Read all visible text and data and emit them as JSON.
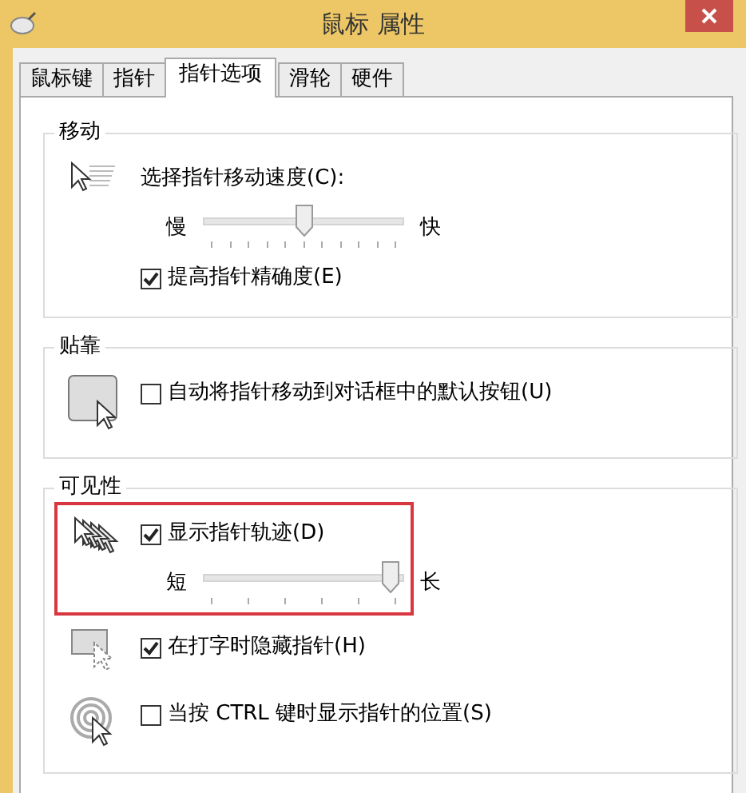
{
  "window": {
    "title": "鼠标 属性"
  },
  "tabs": [
    {
      "label": "鼠标键",
      "selected": false
    },
    {
      "label": "指针",
      "selected": false
    },
    {
      "label": "指针选项",
      "selected": true
    },
    {
      "label": "滑轮",
      "selected": false
    },
    {
      "label": "硬件",
      "selected": false
    }
  ],
  "groups": [
    {
      "title": "移动",
      "rows": [
        {
          "items": [
            {
              "kind": "label",
              "text": "选择指针移动速度(C):"
            },
            {
              "kind": "slider",
              "min_label": "慢",
              "max_label": "快",
              "level": 0.5
            },
            {
              "kind": "checkbox",
              "label": "提高指针精确度(E)",
              "checked": true
            }
          ]
        }
      ]
    },
    {
      "title": "贴靠",
      "rows": [
        {
          "items": [
            {
              "kind": "checkbox",
              "label": "自动将指针移动到对话框中的默认按钮(U)",
              "checked": false
            }
          ]
        }
      ]
    },
    {
      "title": "可见性",
      "rows": [
        {
          "highlighted": true,
          "items": [
            {
              "kind": "checkbox",
              "label": "显示指针轨迹(D)",
              "checked": true
            },
            {
              "kind": "slider",
              "min_label": "短",
              "max_label": "长",
              "level": 0.97
            }
          ]
        },
        {
          "items": [
            {
              "kind": "checkbox",
              "label": "在打字时隐藏指针(H)",
              "checked": true
            }
          ]
        },
        {
          "items": [
            {
              "kind": "checkbox",
              "label": "当按 CTRL 键时显示指针的位置(S)",
              "checked": false
            }
          ]
        }
      ]
    }
  ]
}
